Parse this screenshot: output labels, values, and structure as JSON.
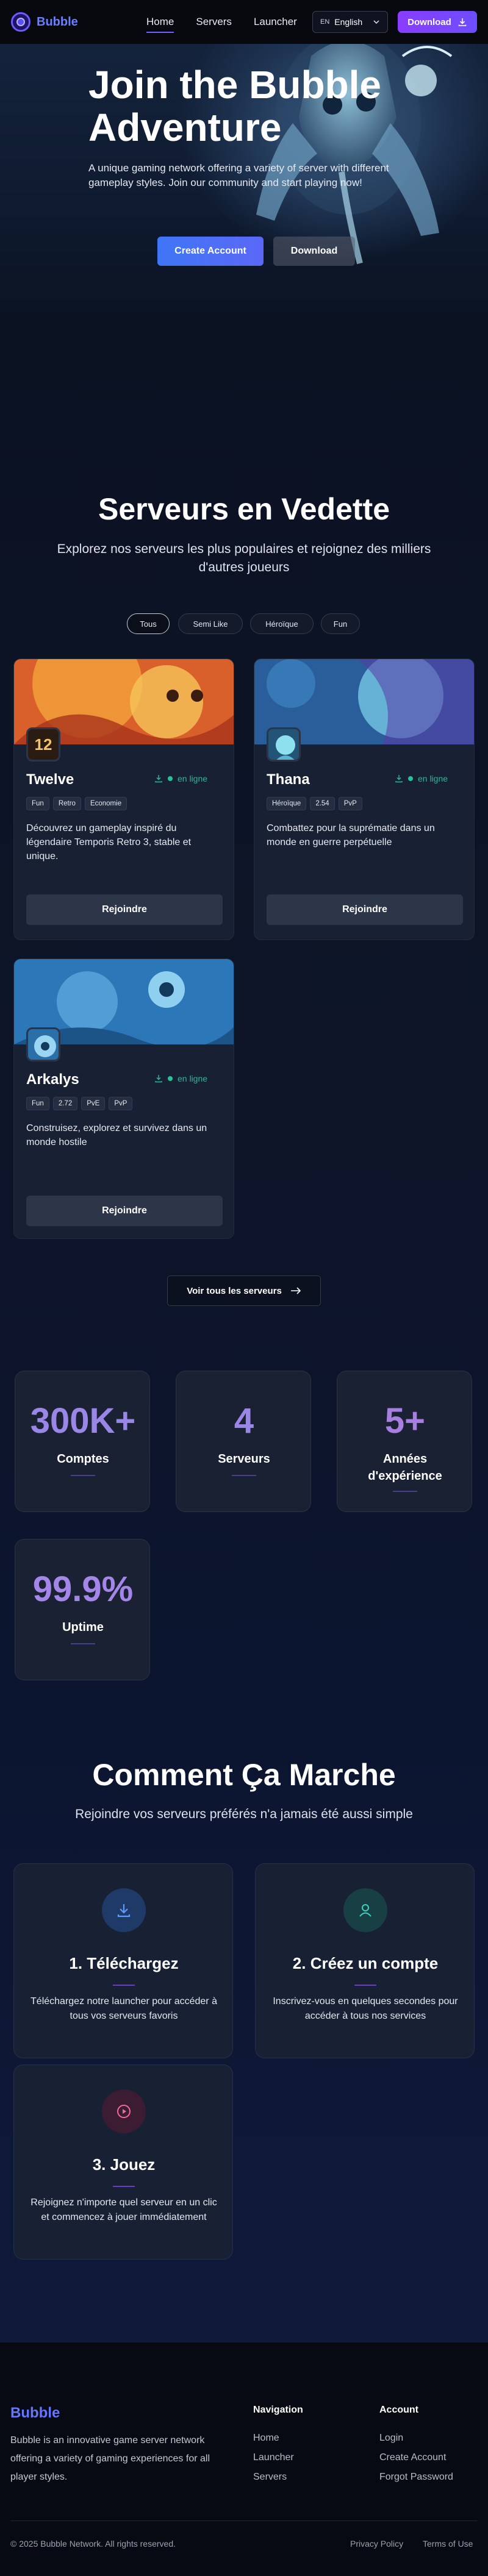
{
  "nav": {
    "brand": "Bubble",
    "links": [
      "Home",
      "Servers",
      "Launcher"
    ],
    "language_code": "EN",
    "language": "English",
    "download": "Download"
  },
  "hero": {
    "title": "Join the Bubble Adventure",
    "text": "A unique gaming network offering a variety of server with different gameplay styles. Join our community and start playing now!",
    "create_account": "Create Account",
    "download": "Download"
  },
  "featured": {
    "title": "Serveurs en Vedette",
    "subtitle": "Explorez nos serveurs les plus populaires et rejoignez des milliers d'autres joueurs",
    "filters": [
      "Tous",
      "Semi Like",
      "Héroïque",
      "Fun"
    ],
    "servers": [
      {
        "name": "Twelve",
        "status": "en ligne",
        "tags": [
          "Fun",
          "Retro",
          "Economie"
        ],
        "desc": "Découvrez un gameplay inspiré du légendaire Temporis Retro 3, stable et unique.",
        "join": "Rejoindre",
        "icon_label": "12"
      },
      {
        "name": "Thana",
        "status": "en ligne",
        "tags": [
          "Héroïque",
          "2.54",
          "PvP"
        ],
        "desc": "Combattez pour la suprématie dans un monde en guerre perpétuelle",
        "join": "Rejoindre"
      },
      {
        "name": "Arkalys",
        "status": "en ligne",
        "tags": [
          "Fun",
          "2.72",
          "PvE",
          "PvP"
        ],
        "desc": "Construisez, explorez et survivez dans un monde hostile",
        "join": "Rejoindre"
      }
    ],
    "view_all": "Voir tous les serveurs"
  },
  "stats": [
    {
      "value": "300K+",
      "label": "Comptes"
    },
    {
      "value": "4",
      "label": "Serveurs"
    },
    {
      "value": "5+",
      "label": "Années d'expérience"
    },
    {
      "value": "99.9%",
      "label": "Uptime"
    }
  ],
  "how": {
    "title": "Comment Ça Marche",
    "subtitle": "Rejoindre vos serveurs préférés n'a jamais été aussi simple",
    "steps": [
      {
        "title": "1. Téléchargez",
        "text": "Téléchargez notre launcher pour accéder à tous vos serveurs favoris",
        "icon": "download-icon"
      },
      {
        "title": "2. Créez un compte",
        "text": "Inscrivez-vous en quelques secondes pour accéder à tous nos services",
        "icon": "user-icon"
      },
      {
        "title": "3. Jouez",
        "text": "Rejoignez n'importe quel serveur en un clic et commencez à jouer immédiatement",
        "icon": "play-icon"
      }
    ]
  },
  "footer": {
    "brand": "Bubble",
    "about": "Bubble is an innovative game server network offering a variety of gaming experiences for all player styles.",
    "navigation_title": "Navigation",
    "navigation": [
      "Home",
      "Launcher",
      "Servers"
    ],
    "account_title": "Account",
    "account": [
      "Login",
      "Create Account",
      "Forgot Password"
    ],
    "copyright": "© 2025 Bubble Network. All rights reserved.",
    "privacy": "Privacy Policy",
    "terms": "Terms of Use"
  },
  "colors": {
    "accent": "#6a63ff",
    "online": "#23c49a",
    "download": "#8a3dff"
  }
}
